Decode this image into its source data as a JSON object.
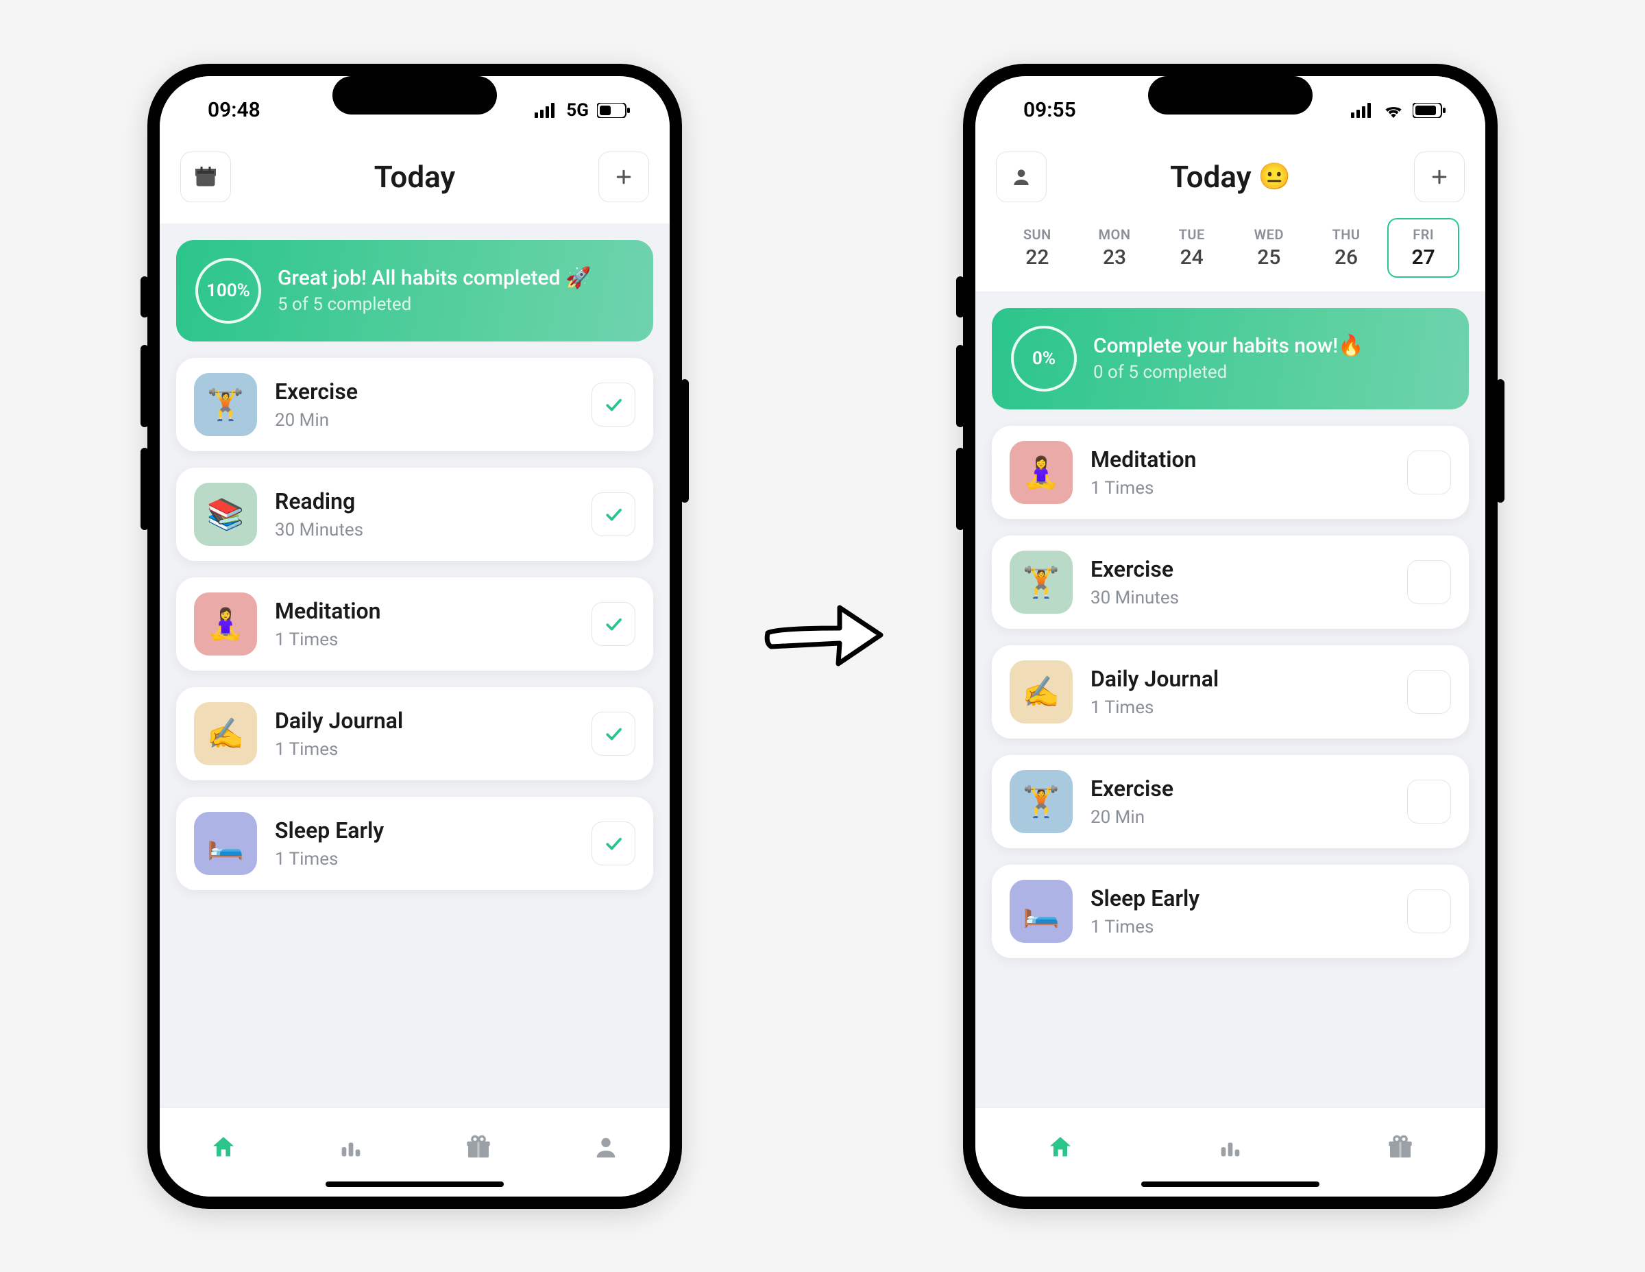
{
  "left": {
    "status": {
      "time": "09:48",
      "net": "5G"
    },
    "header": {
      "title": "Today"
    },
    "banner": {
      "percent": "100%",
      "title": "Great job! All habits completed 🚀",
      "sub": "5 of 5 completed"
    },
    "habits": [
      {
        "title": "Exercise",
        "sub": "20 Min",
        "emoji": "🏋️",
        "bg": "#a8c9de",
        "checked": true
      },
      {
        "title": "Reading",
        "sub": "30 Minutes",
        "emoji": "📚",
        "bg": "#b8dac6",
        "checked": true
      },
      {
        "title": "Meditation",
        "sub": "1 Times",
        "emoji": "🧘‍♀️",
        "bg": "#e9aaa8",
        "checked": true
      },
      {
        "title": "Daily Journal",
        "sub": "1 Times",
        "emoji": "✍️",
        "bg": "#f0dcb7",
        "checked": true
      },
      {
        "title": "Sleep Early",
        "sub": "1 Times",
        "emoji": "🛏️",
        "bg": "#aeb3e6",
        "checked": true
      }
    ],
    "tabs": [
      {
        "name": "home",
        "active": true
      },
      {
        "name": "stats",
        "active": false
      },
      {
        "name": "gift",
        "active": false
      },
      {
        "name": "user",
        "active": false
      }
    ]
  },
  "right": {
    "status": {
      "time": "09:55"
    },
    "header": {
      "title": "Today",
      "emoji": "😐"
    },
    "week": [
      {
        "dow": "SUN",
        "num": "22",
        "active": false
      },
      {
        "dow": "MON",
        "num": "23",
        "active": false
      },
      {
        "dow": "TUE",
        "num": "24",
        "active": false
      },
      {
        "dow": "WED",
        "num": "25",
        "active": false
      },
      {
        "dow": "THU",
        "num": "26",
        "active": false
      },
      {
        "dow": "FRI",
        "num": "27",
        "active": true
      }
    ],
    "banner": {
      "percent": "0%",
      "title": "Complete your habits now!🔥",
      "sub": "0 of 5 completed"
    },
    "habits": [
      {
        "title": "Meditation",
        "sub": "1 Times",
        "emoji": "🧘‍♀️",
        "bg": "#e9aaa8",
        "checked": false
      },
      {
        "title": "Exercise",
        "sub": "30 Minutes",
        "emoji": "🏋️",
        "bg": "#b8dac6",
        "checked": false
      },
      {
        "title": "Daily Journal",
        "sub": "1 Times",
        "emoji": "✍️",
        "bg": "#f0dcb7",
        "checked": false
      },
      {
        "title": "Exercise",
        "sub": "20 Min",
        "emoji": "🏋️",
        "bg": "#a8c9de",
        "checked": false
      },
      {
        "title": "Sleep Early",
        "sub": "1 Times",
        "emoji": "🛏️",
        "bg": "#aeb3e6",
        "checked": false
      }
    ],
    "tabs": [
      {
        "name": "home",
        "active": true
      },
      {
        "name": "stats",
        "active": false
      },
      {
        "name": "gift",
        "active": false
      }
    ]
  }
}
